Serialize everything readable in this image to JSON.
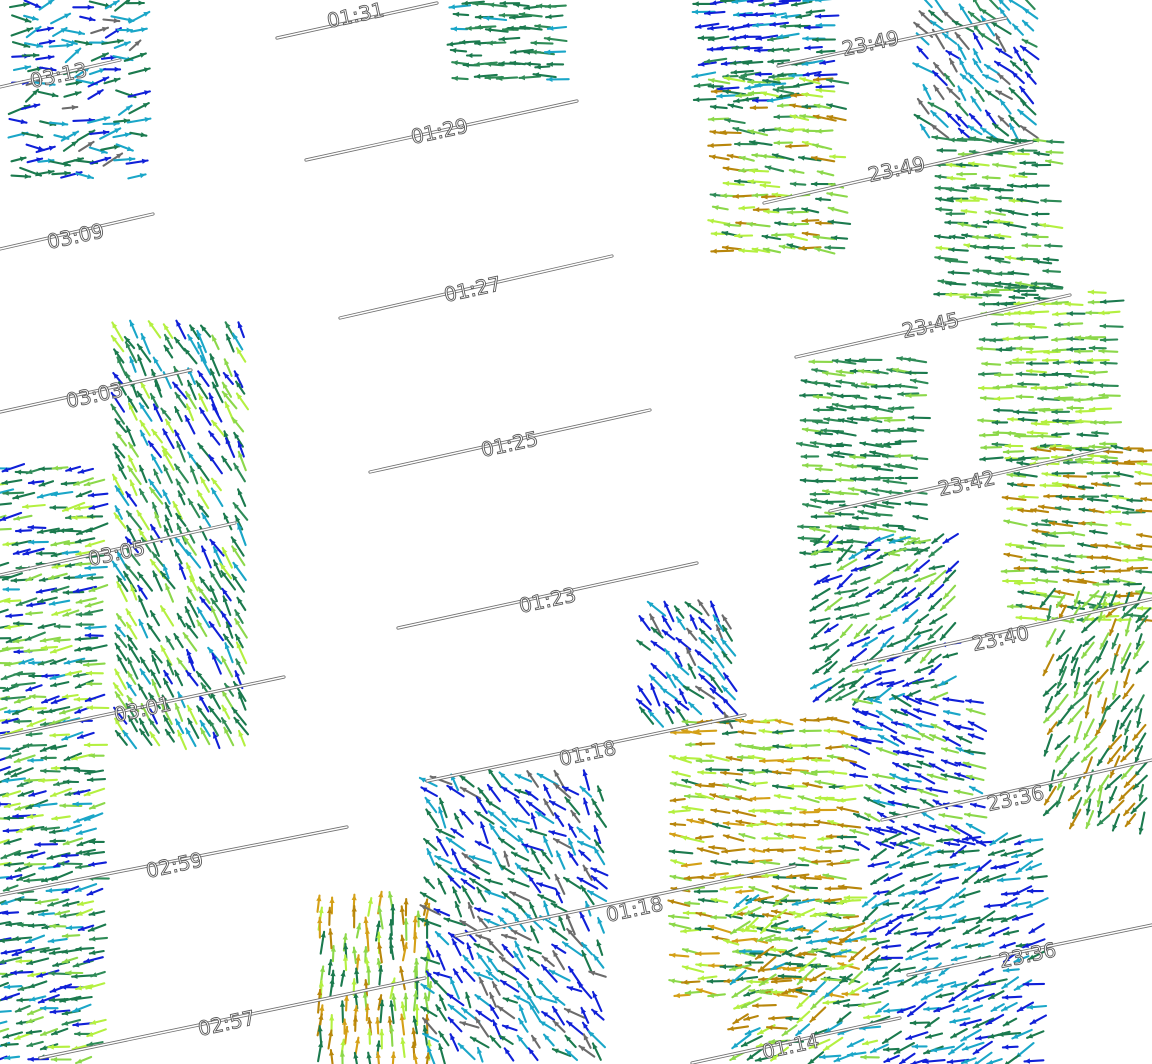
{
  "map": {
    "type": "radar-wind-vector-field",
    "background": "#ffffff",
    "arrow_colors": [
      "#1020d8",
      "#1aa6c8",
      "#1b7a4e",
      "#2e8b57",
      "#8cd84a",
      "#b4f040",
      "#b8860b",
      "#d4a017",
      "#6b6b6b"
    ],
    "icons": [
      "wind-vector-arrow-icon"
    ]
  },
  "tracks": [
    {
      "id": "t1",
      "label": "01:31"
    },
    {
      "id": "t2",
      "label": "01:29"
    },
    {
      "id": "t3",
      "label": "01:27"
    },
    {
      "id": "t4",
      "label": "01:25"
    },
    {
      "id": "t5",
      "label": "01:23"
    },
    {
      "id": "t6",
      "label": "01:18"
    },
    {
      "id": "t7",
      "label": "01:18"
    },
    {
      "id": "t8",
      "label": "03:13"
    },
    {
      "id": "t9",
      "label": "03:09"
    },
    {
      "id": "t10",
      "label": "03:03"
    },
    {
      "id": "t11",
      "label": "03:05"
    },
    {
      "id": "t12",
      "label": "03:01"
    },
    {
      "id": "t13",
      "label": "02:59"
    },
    {
      "id": "t14",
      "label": "02:57"
    },
    {
      "id": "t15",
      "label": "23:49"
    },
    {
      "id": "t16",
      "label": "23:49"
    },
    {
      "id": "t17",
      "label": "23:45"
    },
    {
      "id": "t18",
      "label": "23:42"
    },
    {
      "id": "t19",
      "label": "23:40"
    },
    {
      "id": "t20",
      "label": "23:36"
    },
    {
      "id": "t21",
      "label": "23:36"
    },
    {
      "id": "t22",
      "label": "01:14"
    }
  ]
}
